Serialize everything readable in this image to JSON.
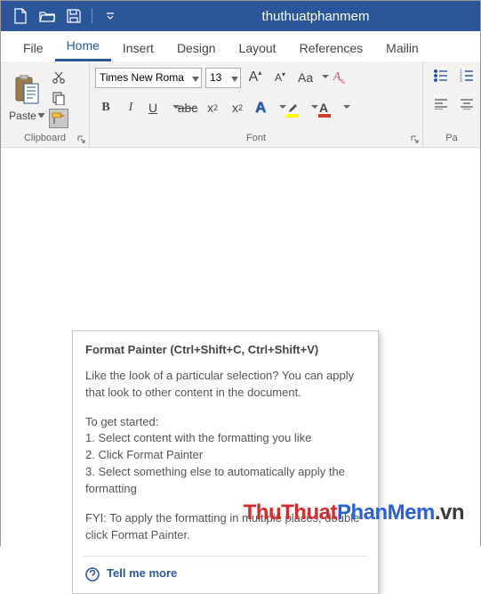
{
  "titlebar": {
    "title": "thuthuatphanmem"
  },
  "tabs": {
    "file": "File",
    "home": "Home",
    "insert": "Insert",
    "design": "Design",
    "layout": "Layout",
    "references": "References",
    "mailings": "Mailin"
  },
  "clipboard": {
    "paste": "Paste",
    "group": "Clipboard"
  },
  "font": {
    "name": "Times New Roma",
    "size": "13",
    "group": "Font",
    "bold": "B",
    "italic": "I",
    "underline": "U",
    "strike": "abc",
    "sub": "x",
    "sup": "x",
    "grow": "A",
    "shrink": "A",
    "case": "Aa",
    "clear": "A"
  },
  "para": {
    "group": "Pa"
  },
  "tooltip": {
    "heading": "Format Painter (Ctrl+Shift+C, Ctrl+Shift+V)",
    "p1": "Like the look of a particular selection? You can apply that look to other content in the document.",
    "p2": "To get started:",
    "s1": "1. Select content with the formatting you like",
    "s2": "2. Click Format Painter",
    "s3": "3. Select something else to automatically apply the formatting",
    "p3": "FYI: To apply the formatting in multiple places, double-click Format Painter.",
    "tellmore": "Tell me more"
  },
  "watermark": {
    "a": "ThuThuat",
    "b": "PhanMem",
    "c": ".vn"
  }
}
